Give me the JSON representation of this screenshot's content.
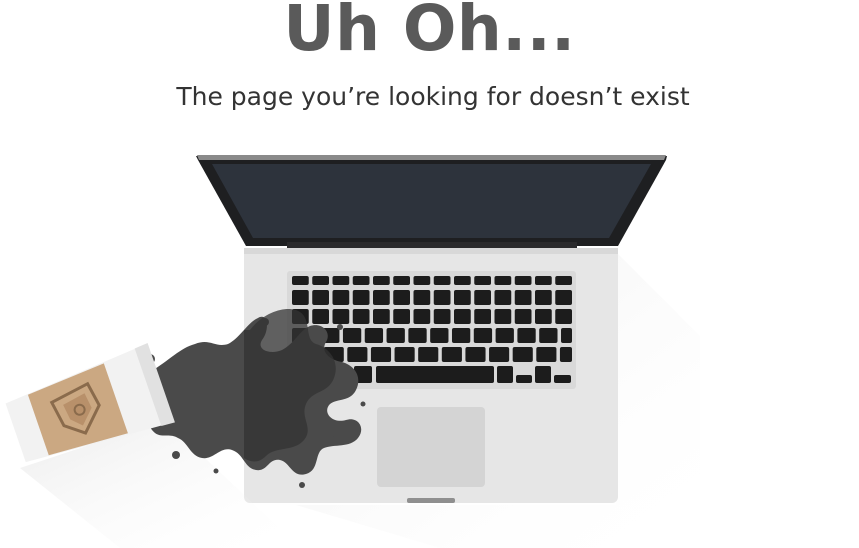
{
  "error_page": {
    "heading": "Uh Oh...",
    "message": "The page you’re looking for doesn’t exist"
  },
  "illustration": {
    "subject": "laptop with spilled coffee cup",
    "icons": [
      "laptop-icon",
      "coffee-cup-icon",
      "coffee-spill-icon",
      "cup-sleeve-logo-icon"
    ]
  },
  "colors": {
    "heading": "#5a5a5a",
    "text": "#333333",
    "screen": "#2d333c",
    "bezel": "#1e1f21",
    "laptop_body": "#e6e6e6",
    "trackpad": "#d4d4d4",
    "key": "#1c1c1c",
    "coffee": "#4a4a4a",
    "cup": "#f2f2f2",
    "sleeve": "#cba882"
  }
}
